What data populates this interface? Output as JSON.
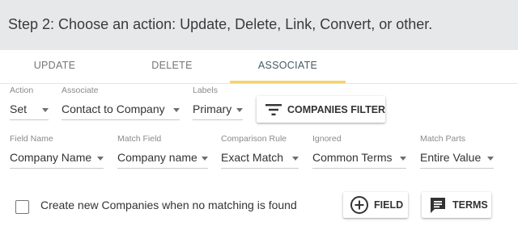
{
  "header": {
    "title": "Step 2: Choose an action: Update, Delete, Link, Convert, or other."
  },
  "tabs": [
    {
      "label": "UPDATE"
    },
    {
      "label": "DELETE"
    },
    {
      "label": "ASSOCIATE",
      "active": true
    }
  ],
  "row1": {
    "action": {
      "label": "Action",
      "value": "Set"
    },
    "associate": {
      "label": "Associate",
      "value": "Contact to Company"
    },
    "labels": {
      "label": "Labels",
      "value": "Primary"
    },
    "filter_button": {
      "label": "COMPANIES FILTER",
      "icon": "filter-icon"
    }
  },
  "row2": {
    "field_name": {
      "label": "Field Name",
      "value": "Company Name"
    },
    "match_field": {
      "label": "Match Field",
      "value": "Company name"
    },
    "comparison_rule": {
      "label": "Comparison Rule",
      "value": "Exact Match"
    },
    "ignored": {
      "label": "Ignored",
      "value": "Common Terms"
    },
    "match_parts": {
      "label": "Match Parts",
      "value": "Entire Value"
    }
  },
  "footer": {
    "create_new_label": "Create new Companies when no matching is found",
    "create_new_checked": false,
    "field_button": {
      "label": "FIELD",
      "icon": "add-circle-icon"
    },
    "terms_button": {
      "label": "TERMS",
      "icon": "message-icon"
    }
  },
  "colors": {
    "header_bg": "#e6e8ea",
    "tab_active": "#455a64",
    "tab_underline": "#f3d36f"
  }
}
